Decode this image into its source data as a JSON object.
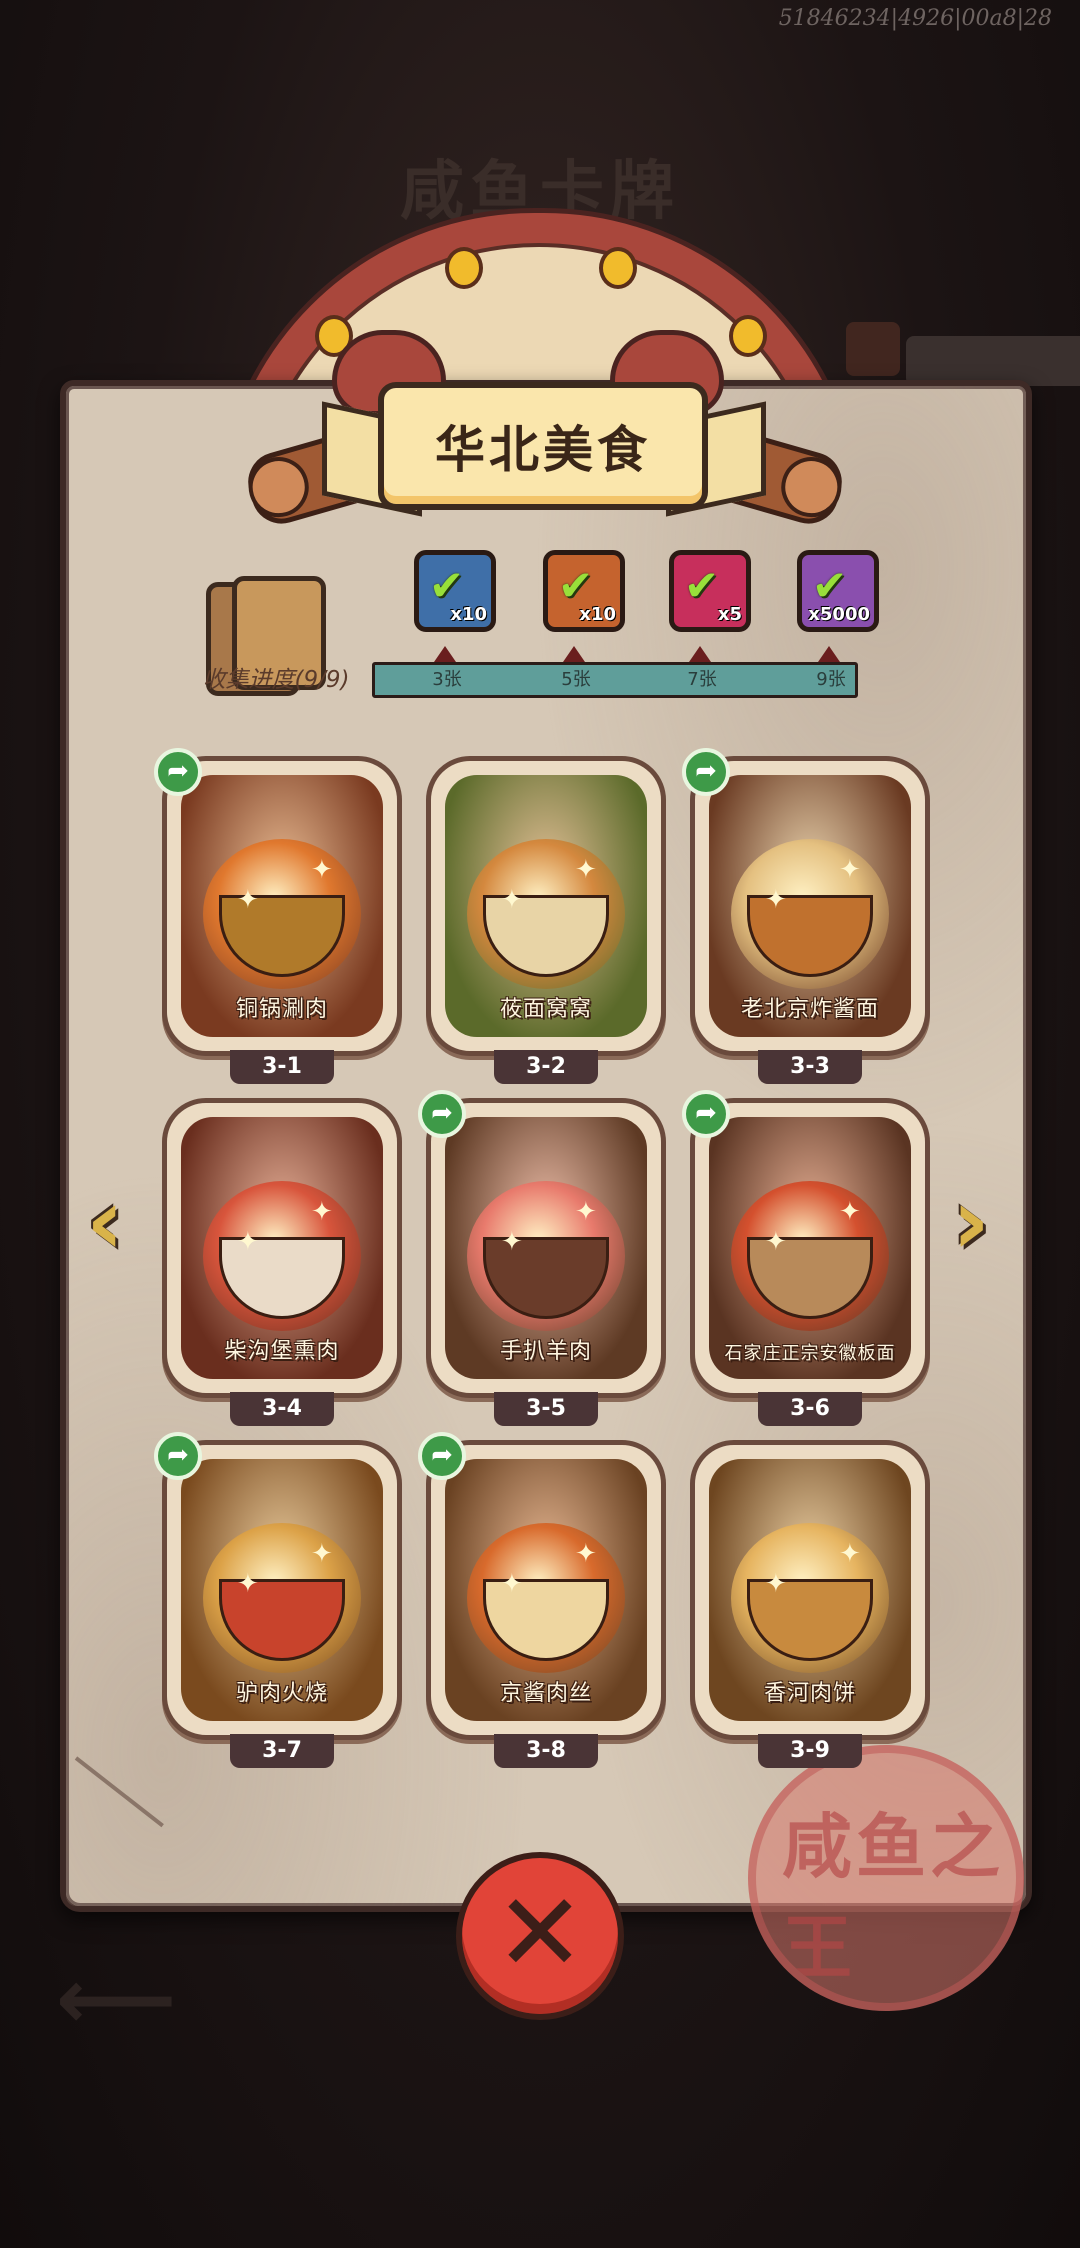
{
  "debug_id": "51846234|4926|00a8|28",
  "panel_title": "华北美食",
  "progress": {
    "label": "收集进度(9/9)",
    "collected": 9,
    "total": 9,
    "milestones": [
      {
        "label": "3张",
        "reward_icon": "treasure-chest-icon",
        "qty": "x10",
        "claimed": true,
        "color": "#3f6fa8"
      },
      {
        "label": "5张",
        "reward_icon": "ticket-icon",
        "qty": "x10",
        "claimed": true,
        "color": "#c5632e"
      },
      {
        "label": "7张",
        "reward_icon": "gem-orb-icon",
        "qty": "x5",
        "claimed": true,
        "color": "#c72f5c"
      },
      {
        "label": "9张",
        "reward_icon": "crystal-icon",
        "qty": "x5000",
        "claimed": true,
        "color": "#8a4fae"
      }
    ]
  },
  "cards": [
    {
      "name": "铜锅涮肉",
      "id": "3-1",
      "shared": true,
      "bg": "#7a3a20",
      "dish": "#e0782e",
      "bowl": "#b07a2a"
    },
    {
      "name": "莜面窝窝",
      "id": "3-2",
      "shared": false,
      "bg": "#5b6a2a",
      "dish": "#d4883e",
      "bowl": "#e8d4a6"
    },
    {
      "name": "老北京炸酱面",
      "id": "3-3",
      "shared": true,
      "bg": "#6a3a22",
      "dish": "#e4c080",
      "bowl": "#c0712e"
    },
    {
      "name": "柴沟堡熏肉",
      "id": "3-4",
      "shared": false,
      "bg": "#6a2e1e",
      "dish": "#d8553c",
      "bowl": "#eadbc8"
    },
    {
      "name": "手扒羊肉",
      "id": "3-5",
      "shared": true,
      "bg": "#5e3a24",
      "dish": "#e87a6c",
      "bowl": "#6a3c2a"
    },
    {
      "name": "石家庄正宗安徽板面",
      "id": "3-6",
      "shared": true,
      "bg": "#5a3422",
      "dish": "#d4502e",
      "bowl": "#b88a5a"
    },
    {
      "name": "驴肉火烧",
      "id": "3-7",
      "shared": true,
      "bg": "#7a4a1e",
      "dish": "#dca248",
      "bowl": "#c8432c"
    },
    {
      "name": "京酱肉丝",
      "id": "3-8",
      "shared": true,
      "bg": "#6a4222",
      "dish": "#d86a2c",
      "bowl": "#eed6a0"
    },
    {
      "name": "香河肉饼",
      "id": "3-9",
      "shared": false,
      "bg": "#6e4620",
      "dish": "#e6b460",
      "bowl": "#c88a3e"
    }
  ],
  "ghost": {
    "title": "咸鱼卡牌"
  },
  "seal_text": "咸鱼之王",
  "nav": {
    "prev_icon": "chevron-left-icon",
    "next_icon": "chevron-right-icon"
  },
  "close_icon": "close-icon"
}
